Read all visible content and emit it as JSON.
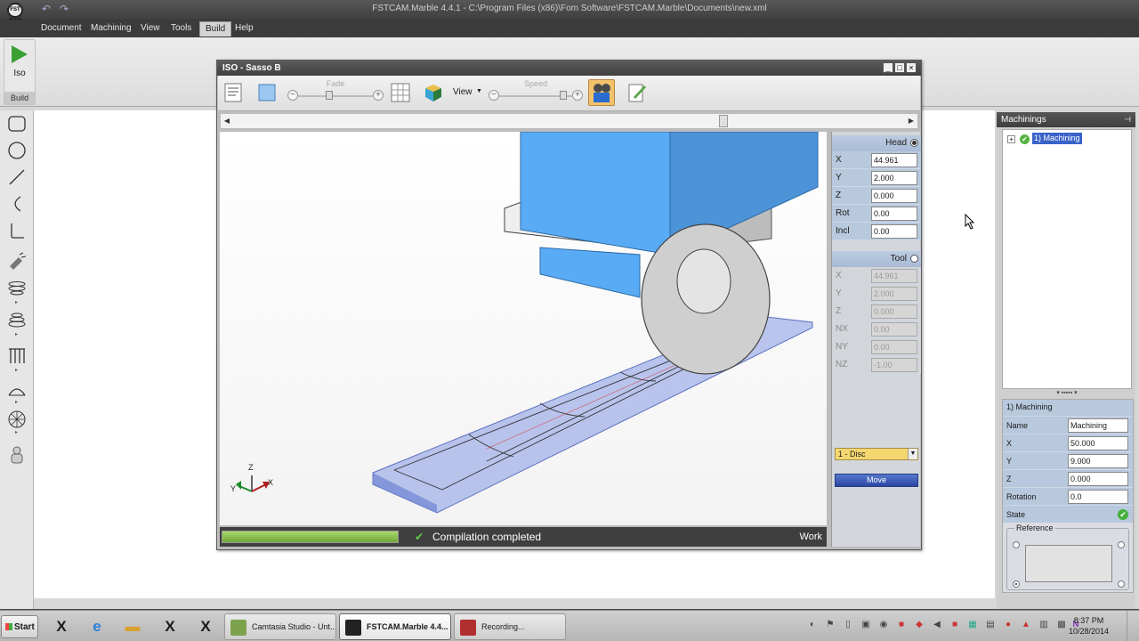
{
  "app": {
    "title": "FSTCAM.Marble 4.4.1 - C:\\Program Files (x86)\\Fom Software\\FSTCAM.Marble\\Documents\\new.xml",
    "logo_text": "FST CAM"
  },
  "menu": [
    "Document",
    "Machining",
    "View",
    "Tools",
    "Build",
    "Help"
  ],
  "menu_active": "Build",
  "ribbon": {
    "iso_label": "Iso",
    "group_label": "Build"
  },
  "left_tools": [
    "rectangle-tool-icon",
    "circle-tool-icon",
    "line-tool-icon",
    "arc-tool-icon",
    "corner-tool-icon",
    "spotlight-tool-icon",
    "spiral-tool-icon",
    "stack-tool-icon",
    "comb-tool-icon",
    "dome-tool-icon",
    "sphere-tool-icon",
    "figure-tool-icon"
  ],
  "iso_window": {
    "title": "ISO  -  Sasso B",
    "fade_label": "Fade",
    "view_label": "View",
    "speed_label": "Speed",
    "status": "Compilation completed",
    "mode": "Work",
    "progress": 1.0,
    "axes": {
      "x": "X",
      "y": "Y",
      "z": "Z"
    }
  },
  "head_panel": {
    "head_label": "Head",
    "head_rows": [
      {
        "label": "X",
        "value": "44.961"
      },
      {
        "label": "Y",
        "value": "2.000"
      },
      {
        "label": "Z",
        "value": "0.000"
      },
      {
        "label": "Rot",
        "value": "0.00"
      },
      {
        "label": "Incl",
        "value": "0.00"
      }
    ],
    "tool_label": "Tool",
    "tool_rows": [
      {
        "label": "X",
        "value": "44.961"
      },
      {
        "label": "Y",
        "value": "2.000"
      },
      {
        "label": "Z",
        "value": "0.000"
      },
      {
        "label": "NX",
        "value": "0.00"
      },
      {
        "label": "NY",
        "value": "0.00"
      },
      {
        "label": "NZ",
        "value": "-1.00"
      }
    ],
    "tool_select": "1 - Disc",
    "move_button": "Move"
  },
  "machinings": {
    "title": "Machinings",
    "tree_item": "1) Machining",
    "props_header": "1) Machining",
    "props": [
      {
        "label": "Name",
        "value": "Machining"
      },
      {
        "label": "X",
        "value": "50.000"
      },
      {
        "label": "Y",
        "value": "9.000"
      },
      {
        "label": "Z",
        "value": "0.000"
      },
      {
        "label": "Rotation",
        "value": "0.0"
      }
    ],
    "state_label": "State",
    "reference_label": "Reference"
  },
  "taskbar": {
    "start": "Start",
    "tasks": [
      "Camtasia Studio - Unt...",
      "FSTCAM.Marble 4.4...",
      "Recording..."
    ],
    "time": "8:37 PM",
    "date": "10/28/2014"
  },
  "colors": {
    "accent": "#3a63c9",
    "head_blue": "#5aabf5",
    "slab": "#8fa2e6",
    "ok_green": "#46b13c"
  }
}
